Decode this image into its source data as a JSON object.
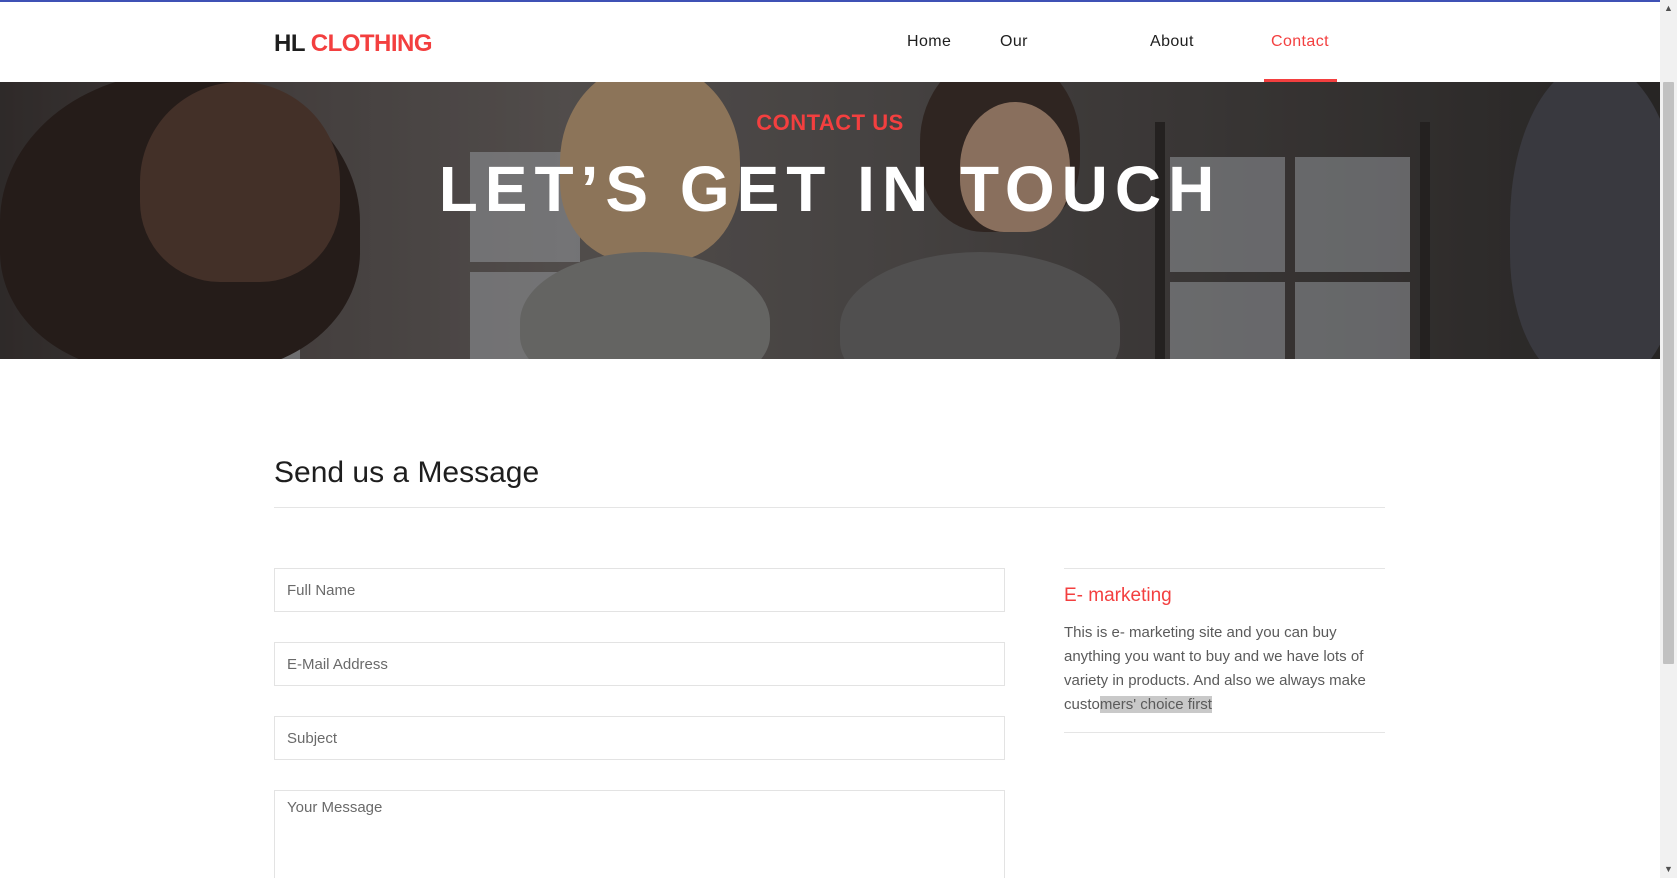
{
  "brand": {
    "prefix": "HL",
    "name": "CLOTHING",
    "accent_color": "#f33f3f"
  },
  "nav": {
    "items": [
      {
        "label": "Home",
        "active": false
      },
      {
        "label": "Our Products",
        "active": false
      },
      {
        "label": "About Us",
        "active": false
      },
      {
        "label": "Contact Us",
        "active": true
      }
    ]
  },
  "hero": {
    "subtitle": "CONTACT US",
    "title": "LET’S GET IN TOUCH"
  },
  "form": {
    "heading": "Send us a Message",
    "full_name_placeholder": "Full Name",
    "email_placeholder": "E-Mail Address",
    "subject_placeholder": "Subject",
    "message_placeholder": "Your Message"
  },
  "aside": {
    "title": "E- marketing",
    "text_plain": "This is e- marketing site and you can buy anything you want to buy and we have lots of variety in products. And also we always make custo",
    "text_highlight": "mers' choice first"
  },
  "scrollbar": {
    "up_icon": "triangle-up",
    "down_icon": "triangle-down"
  }
}
